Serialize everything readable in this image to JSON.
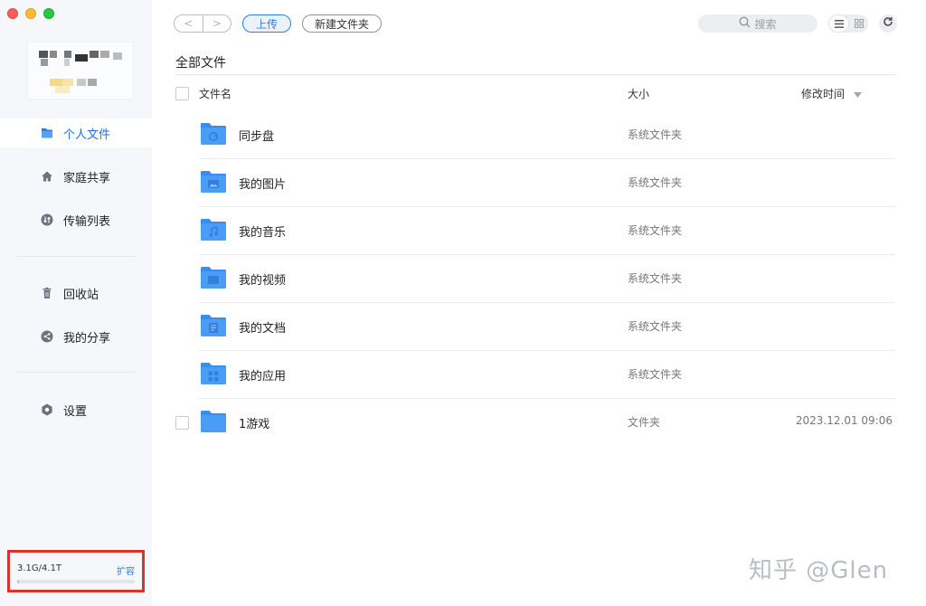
{
  "sidebar": {
    "nav_primary": [
      {
        "label": "个人文件",
        "icon": "file-icon",
        "active": true
      },
      {
        "label": "家庭共享",
        "icon": "home-icon",
        "active": false
      },
      {
        "label": "传输列表",
        "icon": "transfer-icon",
        "active": false
      }
    ],
    "nav_secondary": [
      {
        "label": "回收站",
        "icon": "trash-icon"
      },
      {
        "label": "我的分享",
        "icon": "share-icon"
      }
    ],
    "settings": {
      "label": "设置",
      "icon": "gear-icon"
    },
    "quota": {
      "usage": "3.1G/4.1T",
      "expand_label": "扩容",
      "used_fraction": 0.001
    }
  },
  "toolbar": {
    "back_glyph": "<",
    "forward_glyph": ">",
    "upload_label": "上传",
    "new_folder_label": "新建文件夹",
    "search_placeholder": "搜索",
    "active_view": "list"
  },
  "breadcrumb": "全部文件",
  "columns": {
    "name": "文件名",
    "size": "大小",
    "modified": "修改时间"
  },
  "files": [
    {
      "name": "同步盘",
      "kind": "系统文件夹",
      "time": "",
      "badge": "sync-icon",
      "system": true
    },
    {
      "name": "我的图片",
      "kind": "系统文件夹",
      "time": "",
      "badge": "image-icon",
      "system": true
    },
    {
      "name": "我的音乐",
      "kind": "系统文件夹",
      "time": "",
      "badge": "music-icon",
      "system": true
    },
    {
      "name": "我的视频",
      "kind": "系统文件夹",
      "time": "",
      "badge": "video-icon",
      "system": true
    },
    {
      "name": "我的文档",
      "kind": "系统文件夹",
      "time": "",
      "badge": "document-icon",
      "system": true
    },
    {
      "name": "我的应用",
      "kind": "系统文件夹",
      "time": "",
      "badge": "apps-icon",
      "system": true
    },
    {
      "name": "1游戏",
      "kind": "文件夹",
      "time": "2023.12.01 09:06",
      "badge": "",
      "system": false
    }
  ],
  "watermark": "知乎 @Glen",
  "colors": {
    "accent": "#2b7de9",
    "folder": "#4a9cf5",
    "highlight_border": "#d9342a"
  }
}
